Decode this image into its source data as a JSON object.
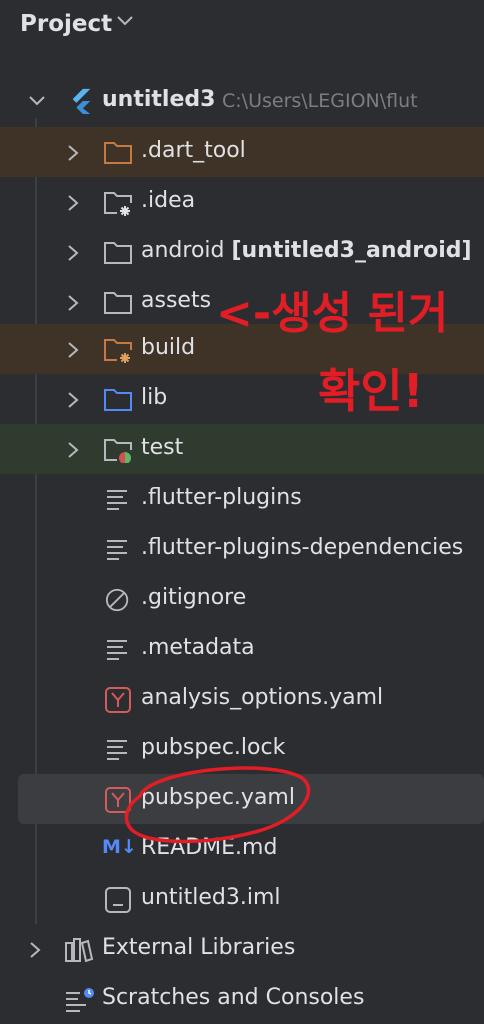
{
  "panel": {
    "title": "Project"
  },
  "root": {
    "name": "untitled3",
    "path": "C:\\Users\\LEGION\\flut"
  },
  "tree": [
    {
      "label": ".dart_tool",
      "icon": "folder-icon"
    },
    {
      "label": ".idea",
      "icon": "folder-settings-icon"
    },
    {
      "label": "android",
      "suffix": "[untitled3_android]",
      "icon": "folder-icon"
    },
    {
      "label": "assets",
      "icon": "folder-icon"
    },
    {
      "label": "build",
      "icon": "folder-excluded-icon"
    },
    {
      "label": "lib",
      "icon": "folder-source-icon"
    },
    {
      "label": "test",
      "icon": "folder-test-icon"
    },
    {
      "label": ".flutter-plugins",
      "icon": "text-file-icon"
    },
    {
      "label": ".flutter-plugins-dependencies",
      "icon": "text-file-icon"
    },
    {
      "label": ".gitignore",
      "icon": "ignore-file-icon"
    },
    {
      "label": ".metadata",
      "icon": "text-file-icon"
    },
    {
      "label": "analysis_options.yaml",
      "icon": "yaml-file-icon"
    },
    {
      "label": "pubspec.lock",
      "icon": "text-file-icon"
    },
    {
      "label": "pubspec.yaml",
      "icon": "yaml-file-icon"
    },
    {
      "label": "README.md",
      "icon": "markdown-file-icon"
    },
    {
      "label": "untitled3.iml",
      "icon": "module-file-icon"
    }
  ],
  "external_libraries": {
    "label": "External Libraries",
    "icon": "library-icon"
  },
  "scratches": {
    "label": "Scratches and Consoles",
    "icon": "scratches-icon"
  },
  "annotation": {
    "line1": "<-생성 된거",
    "line2": "확인!"
  },
  "colors": {
    "background": "#2b2d30",
    "excluded_row": "#3e3326",
    "test_row": "#2f3b2f",
    "selected_row": "#3b3d41",
    "annotation": "#e11d25",
    "folder_orange": "#c57a45",
    "folder_blue": "#548af7"
  }
}
